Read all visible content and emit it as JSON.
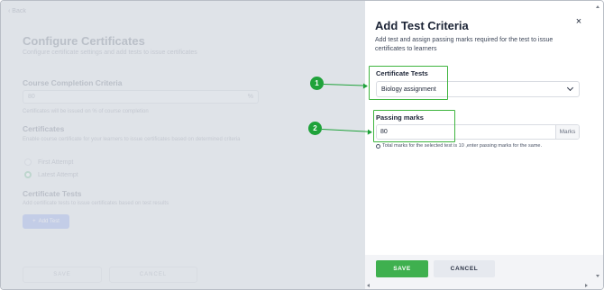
{
  "background_page": {
    "back_link": "‹ Back",
    "title": "Configure Certificates",
    "subtitle": "Configure certificate settings and add tests to issue certificates",
    "course_completion": {
      "label": "Course Completion Criteria",
      "value": "80",
      "suffix": "%",
      "note": "Certificates will be issued on % of course completion"
    },
    "certificates": {
      "label": "Certificates",
      "description": "Enable course certificate for your learners to issue certificates based on determined criteria",
      "options": [
        "First Attempt",
        "Latest Attempt"
      ],
      "selected": "Latest Attempt"
    },
    "certificate_tests": {
      "label": "Certificate Tests",
      "description": "Add certificate tests to issue certificates based on test results",
      "add_button": "Add Test"
    },
    "buttons": {
      "save": "SAVE",
      "cancel": "CANCEL"
    }
  },
  "panel": {
    "title": "Add Test Criteria",
    "description": "Add test and assign passing marks required for the test to issue certificates to learners",
    "close_icon": "×",
    "certificate_tests": {
      "label": "Certificate Tests",
      "selected": "Biology assignment"
    },
    "passing_marks": {
      "label": "Passing marks",
      "value": "80",
      "suffix": "Marks",
      "hint": "Total marks for the selected test is 10 ,enter passing marks for the same."
    },
    "footer": {
      "save": "SAVE",
      "cancel": "CANCEL"
    }
  },
  "annotations": {
    "badge_1": "1",
    "badge_2": "2",
    "color": "#1fa23a"
  },
  "colors": {
    "save_green": "#3fb04f",
    "highlight_green": "#3fb53f",
    "dim_overlay": "#eceef2"
  }
}
